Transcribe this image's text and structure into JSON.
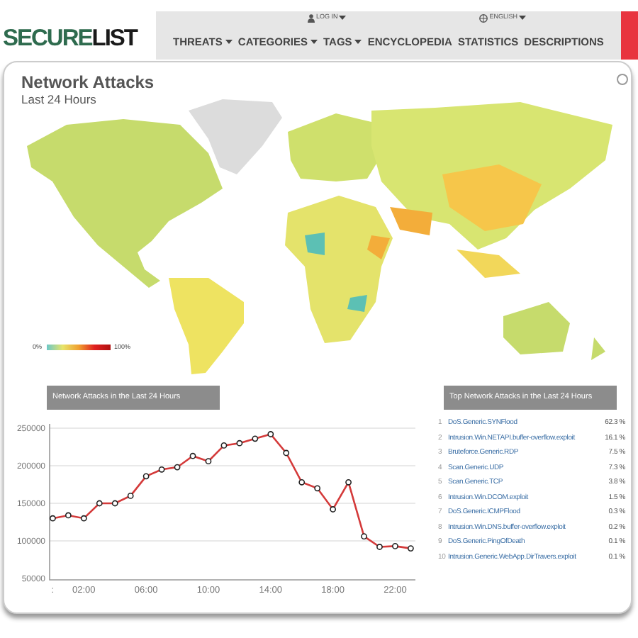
{
  "header": {
    "logo": {
      "first": "SECURE",
      "second": "LIST"
    },
    "utility": [
      {
        "label": "LOG IN",
        "kind": "user"
      },
      {
        "label": "ENGLISH",
        "kind": "globe"
      }
    ],
    "nav": [
      {
        "label": "THREATS",
        "dropdown": true
      },
      {
        "label": "CATEGORIES",
        "dropdown": true
      },
      {
        "label": "TAGS",
        "dropdown": true
      },
      {
        "label": "ENCYCLOPEDIA",
        "dropdown": false
      },
      {
        "label": "STATISTICS",
        "dropdown": false
      },
      {
        "label": "DESCRIPTIONS",
        "dropdown": false
      }
    ]
  },
  "map": {
    "title": "Network Attacks",
    "subtitle": "Last 24 Hours",
    "legend": {
      "min": "0%",
      "max": "100%"
    }
  },
  "chart_panel": {
    "title": "Network Attacks in the Last 24 Hours",
    "chart_data": {
      "type": "line",
      "x": [
        0,
        1,
        2,
        3,
        4,
        5,
        6,
        7,
        8,
        9,
        10,
        11,
        12,
        13,
        14,
        15,
        16,
        17,
        18,
        19,
        20,
        21,
        22,
        23
      ],
      "grid": true,
      "xlim": [
        -0.2,
        23.3
      ],
      "series": [
        {
          "color": "#d43a3a",
          "marker": "circle",
          "values": [
            130000,
            134000,
            130000,
            150000,
            150000,
            160000,
            186000,
            195000,
            198000,
            213000,
            206000,
            227000,
            230000,
            236000,
            242000,
            217000,
            178000,
            170000,
            142000,
            178000,
            106000,
            92000,
            93000,
            90000
          ]
        }
      ],
      "ylim": [
        50000,
        250000
      ],
      "yticks": [
        50000,
        100000,
        150000,
        200000,
        250000
      ],
      "xticks": [
        {
          "value": 0,
          "label": ":"
        },
        {
          "value": 2,
          "label": "02:00"
        },
        {
          "value": 6,
          "label": "06:00"
        },
        {
          "value": 10,
          "label": "10:00"
        },
        {
          "value": 14,
          "label": "14:00"
        },
        {
          "value": 18,
          "label": "18:00"
        },
        {
          "value": 22,
          "label": "22:00"
        }
      ]
    }
  },
  "top_panel": {
    "title": "Top Network Attacks in the Last 24 Hours",
    "items": [
      {
        "rank": "1",
        "name": "DoS.Generic.SYNFlood",
        "share": "62.3 %"
      },
      {
        "rank": "2",
        "name": "Intrusion.Win.NETAPI.buffer-overflow.exploit",
        "share": "16.1 %"
      },
      {
        "rank": "3",
        "name": "Bruteforce.Generic.RDP",
        "share": "7.5 %"
      },
      {
        "rank": "4",
        "name": "Scan.Generic.UDP",
        "share": "7.3 %"
      },
      {
        "rank": "5",
        "name": "Scan.Generic.TCP",
        "share": "3.8 %"
      },
      {
        "rank": "6",
        "name": "Intrusion.Win.DCOM.exploit",
        "share": "1.5 %"
      },
      {
        "rank": "7",
        "name": "DoS.Generic.ICMPFlood",
        "share": "0.3 %"
      },
      {
        "rank": "8",
        "name": "Intrusion.Win.DNS.buffer-overflow.exploit",
        "share": "0.2 %"
      },
      {
        "rank": "9",
        "name": "DoS.Generic.PingOfDeath",
        "share": "0.1 %"
      },
      {
        "rank": "10",
        "name": "Intrusion.Generic.WebApp.DirTravers.exploit",
        "share": "0.1 %"
      }
    ]
  }
}
